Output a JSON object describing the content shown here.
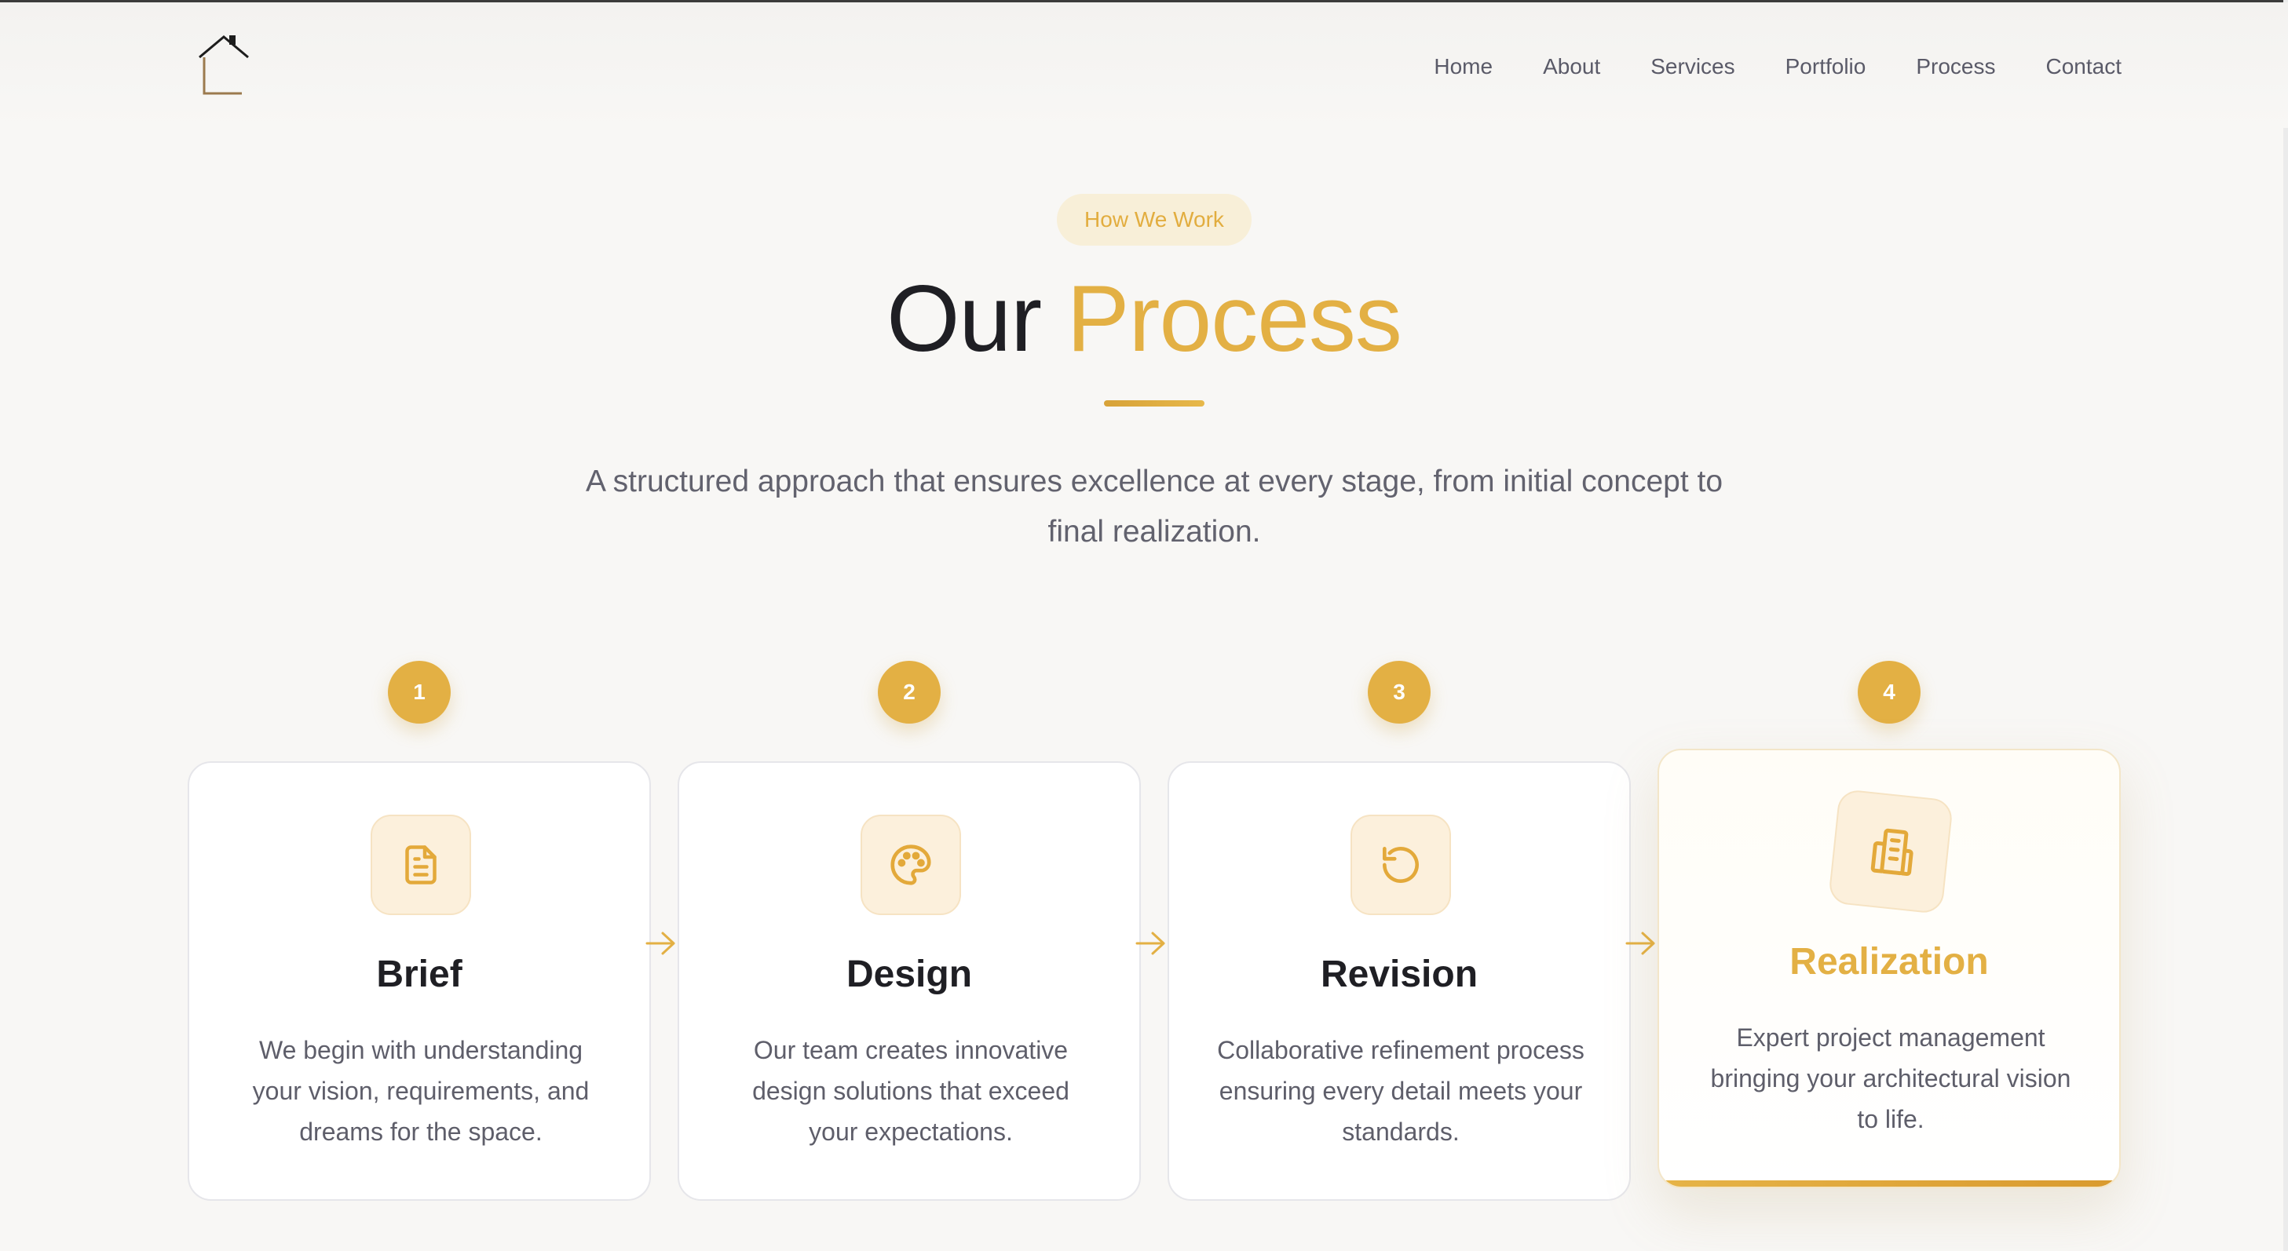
{
  "nav": {
    "items": [
      "Home",
      "About",
      "Services",
      "Portfolio",
      "Process",
      "Contact"
    ]
  },
  "hero": {
    "badge": "How We Work",
    "title_part1": "Our",
    "title_part2": "Process",
    "subtitle": "A structured approach that ensures excellence at every stage, from initial concept to final realization."
  },
  "steps": [
    {
      "number": "1",
      "title": "Brief",
      "description": "We begin with understanding your vision, requirements, and dreams for the space.",
      "icon": "document-icon"
    },
    {
      "number": "2",
      "title": "Design",
      "description": "Our team creates innovative design solutions that exceed your expectations.",
      "icon": "palette-icon"
    },
    {
      "number": "3",
      "title": "Revision",
      "description": "Collaborative refinement process ensuring every detail meets your standards.",
      "icon": "refresh-icon"
    },
    {
      "number": "4",
      "title": "Realization",
      "description": "Expert project management bringing your architectural vision to life.",
      "icon": "building-icon"
    }
  ],
  "colors": {
    "accent": "#e3b044",
    "background": "#f8f7f5",
    "text_dark": "#1f1f24",
    "text_muted": "#5e5e6a"
  }
}
